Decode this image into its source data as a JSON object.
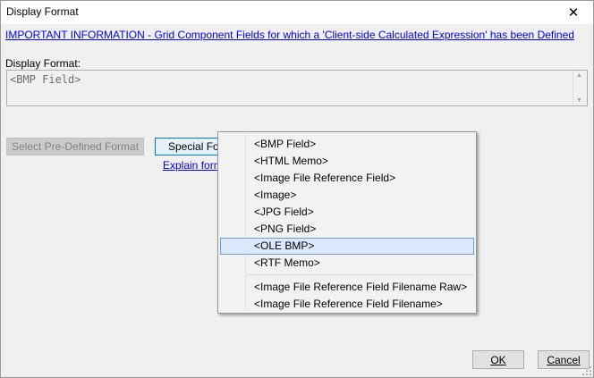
{
  "window": {
    "title": "Display Format"
  },
  "info_link": "IMPORTANT INFORMATION - Grid Component Fields for which a 'Client-side Calculated Expression' has been Defined",
  "display_format": {
    "label": "Display Format:",
    "value": "<BMP Field>"
  },
  "buttons": {
    "select_predefined": "Select Pre-Defined Format",
    "special_formats": "Special Formats",
    "ok": "OK",
    "cancel": "Cancel"
  },
  "explain_link": "Explain formats",
  "menu": {
    "group1": [
      "<BMP Field>",
      "<HTML Memo>",
      "<Image File Reference Field>",
      "<Image>",
      "<JPG Field>",
      "<PNG Field>",
      "<OLE BMP>",
      "<RTF Memo>"
    ],
    "group2": [
      "<Image File Reference Field Filename Raw>",
      "<Image File Reference Field Filename>"
    ],
    "highlighted": "<OLE BMP>"
  }
}
